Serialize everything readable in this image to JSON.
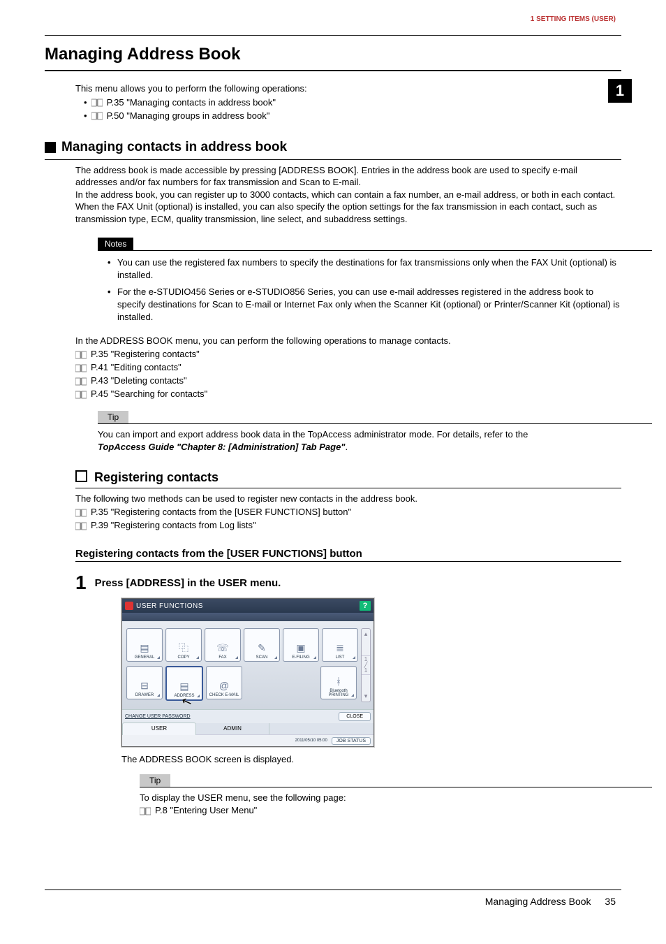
{
  "header": {
    "section_label": "1 SETTING ITEMS (USER)"
  },
  "side_tab": {
    "number": "1"
  },
  "title": "Managing Address Book",
  "intro": {
    "lead": "This menu allows you to perform the following operations:",
    "items": [
      "P.35 \"Managing contacts in address book\"",
      "P.50 \"Managing groups in address book\""
    ]
  },
  "sec1": {
    "heading": "Managing contacts in address book",
    "para1": "The address book is made accessible by pressing [ADDRESS BOOK]. Entries in the address book are used to specify e-mail addresses and/or fax numbers for fax transmission and Scan to E-mail.",
    "para2": "In the address book, you can register up to 3000 contacts, which can contain a fax number, an e-mail address, or both in each contact. When the FAX Unit (optional) is installed, you can also specify the option settings for the fax transmission in each contact, such as transmission type, ECM, quality transmission, line select, and subaddress settings.",
    "notes_label": "Notes",
    "notes": [
      "You can use the registered fax numbers to specify the destinations for fax transmissions only when the FAX Unit (optional) is installed.",
      "For the e-STUDIO456 Series or e-STUDIO856 Series, you can use e-mail addresses registered in the address book to specify destinations for Scan to E-mail or Internet Fax only when the Scanner Kit (optional) or Printer/Scanner Kit (optional) is installed."
    ],
    "lead2": "In the ADDRESS BOOK menu, you can perform the following operations to manage contacts.",
    "refs": [
      "P.35 \"Registering contacts\"",
      "P.41 \"Editing contacts\"",
      "P.43 \"Deleting contacts\"",
      "P.45 \"Searching for contacts\""
    ],
    "tip_label": "Tip",
    "tip_text": "You can import and export address book data in the TopAccess administrator mode. For details, refer to the ",
    "tip_ref": "TopAccess Guide \"Chapter 8: [Administration] Tab Page\"",
    "tip_tail": "."
  },
  "sec2": {
    "heading": "Registering contacts",
    "lead": "The following two methods can be used to register new contacts in the address book.",
    "refs": [
      "P.35 \"Registering contacts from the [USER FUNCTIONS] button\"",
      "P.39 \"Registering contacts from Log lists\""
    ]
  },
  "sec3": {
    "heading": "Registering contacts from the [USER FUNCTIONS] button"
  },
  "step1": {
    "num": "1",
    "text": "Press [ADDRESS] in the USER menu.",
    "after": "The ADDRESS BOOK screen is displayed.",
    "tip_label": "Tip",
    "tip_body": "To display the USER menu, see the following page:",
    "tip_ref": "P.8 \"Entering User Menu\""
  },
  "mfp": {
    "title": "USER FUNCTIONS",
    "help": "?",
    "row1": [
      "GENERAL",
      "COPY",
      "FAX",
      "SCAN",
      "E-FILING",
      "LIST"
    ],
    "row2": [
      "DRAWER",
      "ADDRESS",
      "CHECK E-MAIL",
      "",
      "",
      "Bluetooth PRINTING"
    ],
    "scroll": {
      "up": "▴",
      "page": "1 / 1",
      "down": "▾"
    },
    "change_pw": "CHANGE USER PASSWORD",
    "close": "CLOSE",
    "tabs": [
      "USER",
      "ADMIN"
    ],
    "datetime": "2011/05/10  05:00",
    "job": "JOB STATUS"
  },
  "footer": {
    "text": "Managing Address Book",
    "page": "35"
  }
}
